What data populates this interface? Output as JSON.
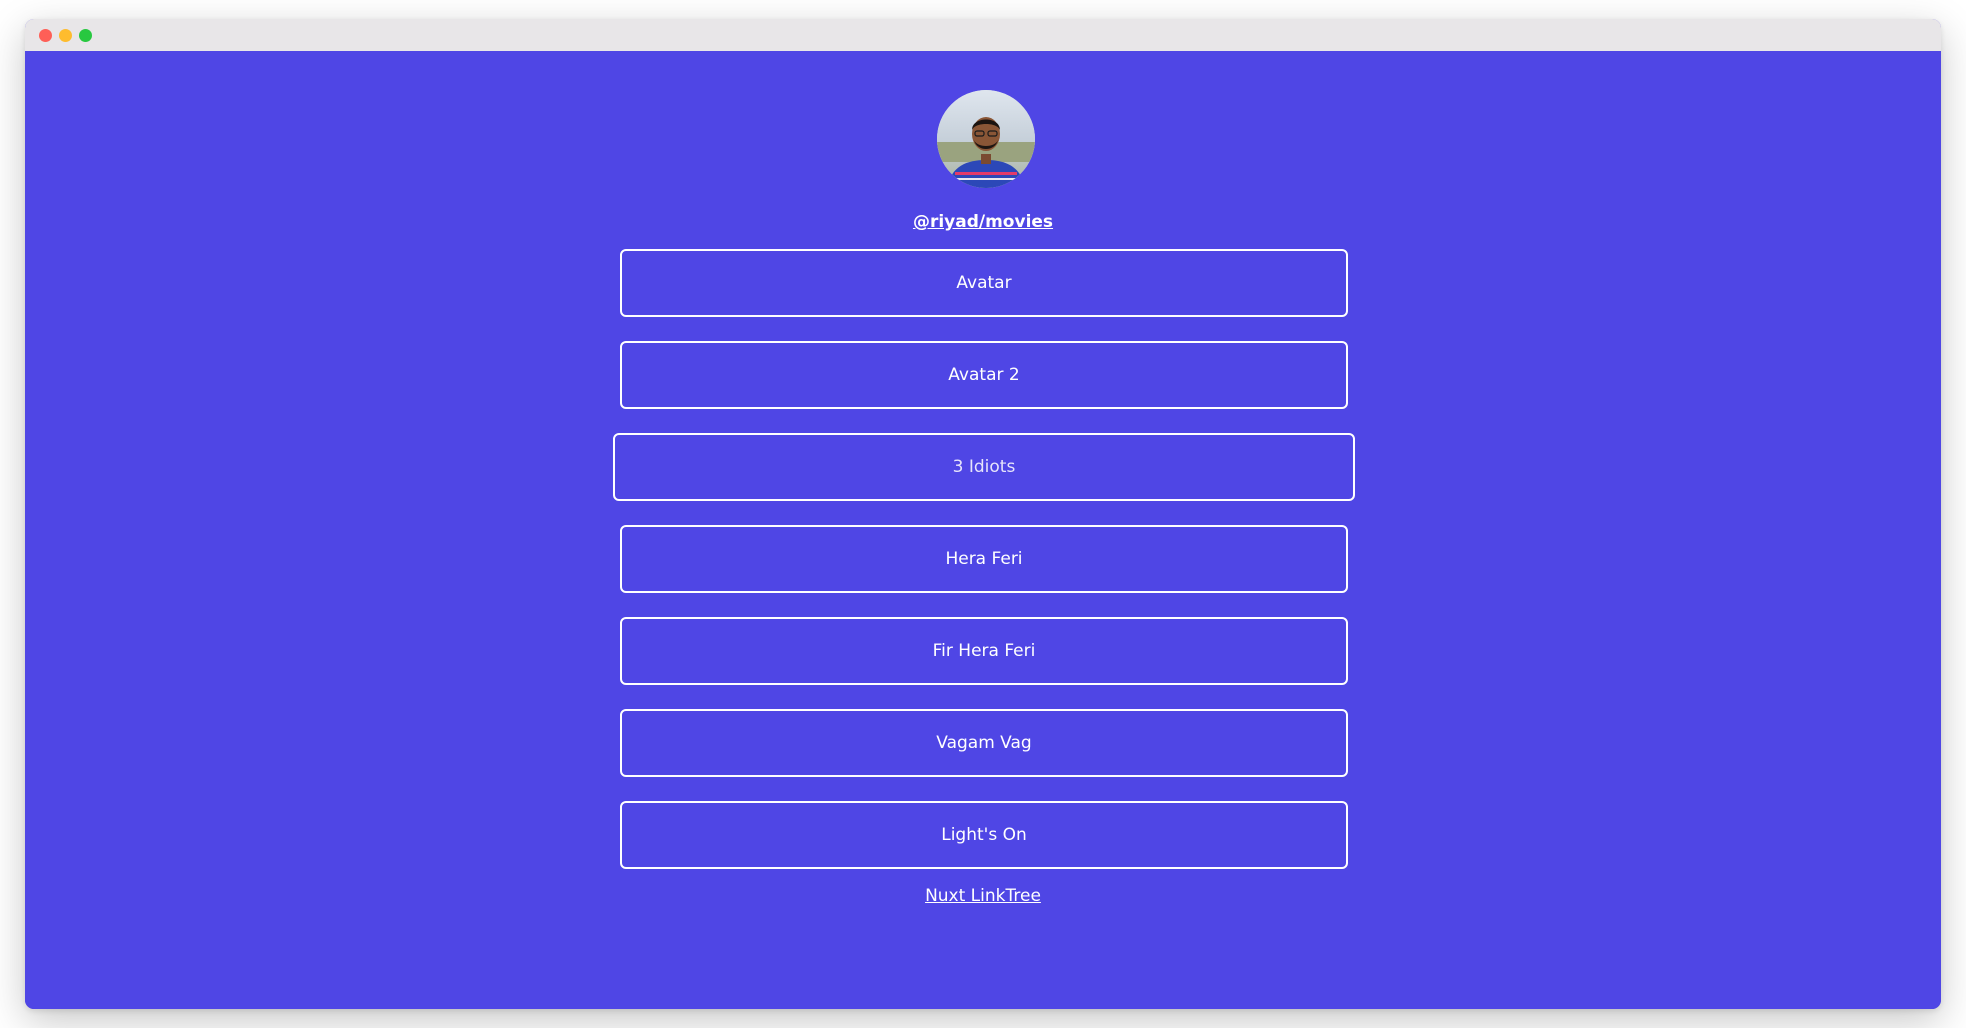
{
  "profile": {
    "handle": "@riyad/movies",
    "avatar_icon": "profile-photo"
  },
  "links": [
    {
      "label": "Avatar"
    },
    {
      "label": "Avatar 2"
    },
    {
      "label": "3 Idiots"
    },
    {
      "label": "Hera Feri"
    },
    {
      "label": "Fir Hera Feri"
    },
    {
      "label": "Vagam Vag"
    },
    {
      "label": "Light's On"
    }
  ],
  "footer": {
    "label": "Nuxt LinkTree"
  },
  "colors": {
    "background": "#4f46e5",
    "text": "#ffffff",
    "titlebar": "#e8e6e8"
  }
}
